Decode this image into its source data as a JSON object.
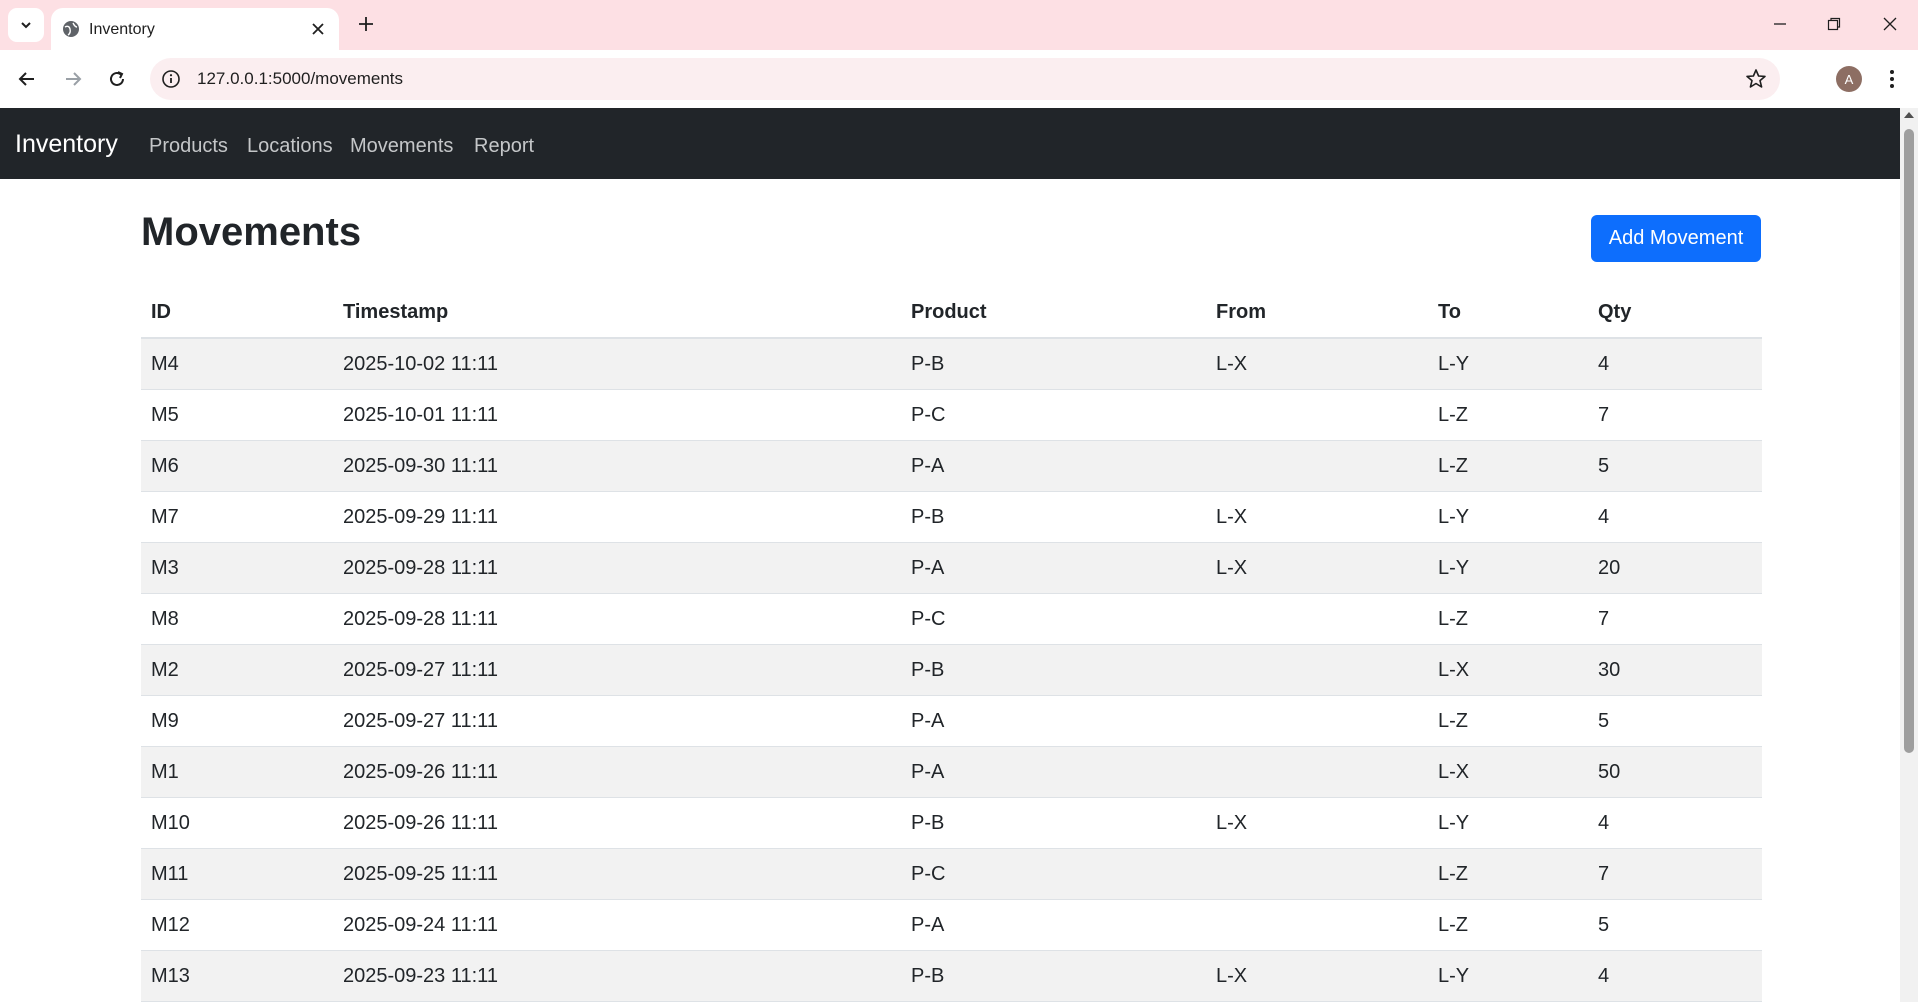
{
  "browser": {
    "tab_title": "Inventory",
    "url": "127.0.0.1:5000/movements",
    "profile_initial": "A"
  },
  "navbar": {
    "brand": "Inventory",
    "links": [
      "Products",
      "Locations",
      "Movements",
      "Report"
    ]
  },
  "page": {
    "title": "Movements",
    "add_button": "Add Movement"
  },
  "table": {
    "columns": [
      "ID",
      "Timestamp",
      "Product",
      "From",
      "To",
      "Qty"
    ],
    "rows": [
      [
        "M4",
        "2025-10-02 11:11",
        "P-B",
        "L-X",
        "L-Y",
        "4"
      ],
      [
        "M5",
        "2025-10-01 11:11",
        "P-C",
        "",
        "L-Z",
        "7"
      ],
      [
        "M6",
        "2025-09-30 11:11",
        "P-A",
        "",
        "L-Z",
        "5"
      ],
      [
        "M7",
        "2025-09-29 11:11",
        "P-B",
        "L-X",
        "L-Y",
        "4"
      ],
      [
        "M3",
        "2025-09-28 11:11",
        "P-A",
        "L-X",
        "L-Y",
        "20"
      ],
      [
        "M8",
        "2025-09-28 11:11",
        "P-C",
        "",
        "L-Z",
        "7"
      ],
      [
        "M2",
        "2025-09-27 11:11",
        "P-B",
        "",
        "L-X",
        "30"
      ],
      [
        "M9",
        "2025-09-27 11:11",
        "P-A",
        "",
        "L-Z",
        "5"
      ],
      [
        "M1",
        "2025-09-26 11:11",
        "P-A",
        "",
        "L-X",
        "50"
      ],
      [
        "M10",
        "2025-09-26 11:11",
        "P-B",
        "L-X",
        "L-Y",
        "4"
      ],
      [
        "M11",
        "2025-09-25 11:11",
        "P-C",
        "",
        "L-Z",
        "7"
      ],
      [
        "M12",
        "2025-09-24 11:11",
        "P-A",
        "",
        "L-Z",
        "5"
      ],
      [
        "M13",
        "2025-09-23 11:11",
        "P-B",
        "L-X",
        "L-Y",
        "4"
      ]
    ]
  },
  "colors": {
    "navbar_bg": "#212529",
    "primary_button": "#0d6efd",
    "tabstrip_bg": "#fde0e4"
  }
}
